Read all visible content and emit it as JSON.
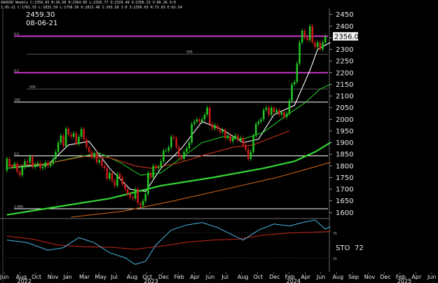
{
  "header": {
    "line1": "XAUUSD Weekly C:2356.03 N:26.58 H:2364.85 L:2326.77 O:2329.48 U:2356.33 V:66.1K O:0",
    "line2": "I:95-21 C:1761.55 L:1831.59 L:1758.56 O:1813.48 I:293.58 I:0 S:2356.03 R:73.03 E:62.54",
    "price": "2459.30",
    "date": "08-06-21"
  },
  "chart_data": {
    "type": "line",
    "title": "",
    "ylim": [
      1580,
      2470
    ],
    "yticks": [
      1600,
      1650,
      1700,
      1750,
      1800,
      1850,
      1900,
      1950,
      2000,
      2050,
      2100,
      2150,
      2200,
      2250,
      2300,
      2350,
      2400,
      2450
    ],
    "last_price_label": "2356.03",
    "last_price": 2356.03,
    "horizontal_lines": [
      {
        "value": 2357,
        "color": "#c838c8",
        "label": "0.0"
      },
      {
        "value": 2200,
        "color": "#c838c8",
        "label": "0.2"
      },
      {
        "value": 2074,
        "color": "#ffffff",
        "label": "100"
      },
      {
        "value": 1843,
        "color": "#ffffff",
        "label": "0.5"
      },
      {
        "value": 1616,
        "color": "#ffffff",
        "label": "1.000"
      }
    ],
    "level_labels": [
      {
        "value": 2280,
        "label": "500"
      },
      {
        "value": 2130,
        "label": "500"
      }
    ],
    "candles": [
      [
        1780,
        1832
      ],
      [
        1830,
        1800
      ],
      [
        1800,
        1795
      ],
      [
        1795,
        1810
      ],
      [
        1810,
        1775
      ],
      [
        1775,
        1760
      ],
      [
        1760,
        1795
      ],
      [
        1795,
        1820
      ],
      [
        1820,
        1815
      ],
      [
        1815,
        1840
      ],
      [
        1840,
        1795
      ],
      [
        1795,
        1805
      ],
      [
        1805,
        1812
      ],
      [
        1812,
        1790
      ],
      [
        1790,
        1795
      ],
      [
        1795,
        1815
      ],
      [
        1815,
        1800
      ],
      [
        1800,
        1810
      ],
      [
        1810,
        1830
      ],
      [
        1830,
        1860
      ],
      [
        1860,
        1900
      ],
      [
        1900,
        1930
      ],
      [
        1930,
        1885
      ],
      [
        1885,
        1960
      ],
      [
        1960,
        1935
      ],
      [
        1935,
        1925
      ],
      [
        1925,
        1940
      ],
      [
        1940,
        1895
      ],
      [
        1895,
        1925
      ],
      [
        1925,
        1958
      ],
      [
        1958,
        1915
      ],
      [
        1915,
        1880
      ],
      [
        1880,
        1860
      ],
      [
        1860,
        1840
      ],
      [
        1840,
        1855
      ],
      [
        1855,
        1815
      ],
      [
        1815,
        1825
      ],
      [
        1825,
        1800
      ],
      [
        1800,
        1790
      ],
      [
        1790,
        1745
      ],
      [
        1745,
        1770
      ],
      [
        1770,
        1735
      ],
      [
        1735,
        1715
      ],
      [
        1715,
        1765
      ],
      [
        1765,
        1750
      ],
      [
        1750,
        1720
      ],
      [
        1720,
        1700
      ],
      [
        1700,
        1680
      ],
      [
        1680,
        1665
      ],
      [
        1665,
        1660
      ],
      [
        1660,
        1700
      ],
      [
        1700,
        1640
      ],
      [
        1640,
        1630
      ],
      [
        1630,
        1650
      ],
      [
        1650,
        1680
      ],
      [
        1680,
        1770
      ],
      [
        1770,
        1750
      ],
      [
        1750,
        1800
      ],
      [
        1800,
        1790
      ],
      [
        1790,
        1795
      ],
      [
        1795,
        1820
      ],
      [
        1820,
        1865
      ],
      [
        1865,
        1865
      ],
      [
        1865,
        1880
      ],
      [
        1880,
        1925
      ],
      [
        1925,
        1920
      ],
      [
        1920,
        1880
      ],
      [
        1880,
        1840
      ],
      [
        1840,
        1830
      ],
      [
        1830,
        1860
      ],
      [
        1860,
        1875
      ],
      [
        1875,
        1900
      ],
      [
        1900,
        1980
      ],
      [
        1980,
        1990
      ],
      [
        1990,
        2000
      ],
      [
        2000,
        1990
      ],
      [
        1990,
        2000
      ],
      [
        2000,
        2020
      ],
      [
        2020,
        2050
      ],
      [
        2050,
        1980
      ],
      [
        1980,
        1960
      ],
      [
        1960,
        1975
      ],
      [
        1975,
        1960
      ],
      [
        1960,
        1945
      ],
      [
        1945,
        1955
      ],
      [
        1955,
        1920
      ],
      [
        1920,
        1930
      ],
      [
        1930,
        1905
      ],
      [
        1905,
        1920
      ],
      [
        1920,
        1930
      ],
      [
        1930,
        1910
      ],
      [
        1910,
        1920
      ],
      [
        1920,
        1890
      ],
      [
        1890,
        1870
      ],
      [
        1870,
        1830
      ],
      [
        1830,
        1860
      ],
      [
        1860,
        1930
      ],
      [
        1930,
        1980
      ],
      [
        1980,
        1990
      ],
      [
        1990,
        2000
      ],
      [
        2000,
        2040
      ],
      [
        2040,
        2050
      ],
      [
        2050,
        2020
      ],
      [
        2020,
        2050
      ],
      [
        2050,
        2030
      ],
      [
        2030,
        2040
      ],
      [
        2040,
        2020
      ],
      [
        2020,
        2030
      ],
      [
        2030,
        2010
      ],
      [
        2010,
        2025
      ],
      [
        2025,
        2080
      ],
      [
        2080,
        2150
      ],
      [
        2150,
        2160
      ],
      [
        2160,
        2240
      ],
      [
        2240,
        2330
      ],
      [
        2330,
        2380
      ],
      [
        2380,
        2350
      ],
      [
        2350,
        2340
      ],
      [
        2340,
        2400
      ],
      [
        2400,
        2330
      ],
      [
        2330,
        2310
      ],
      [
        2310,
        2330
      ],
      [
        2330,
        2300
      ],
      [
        2300,
        2330
      ],
      [
        2330,
        2356
      ]
    ],
    "series": [
      {
        "color": "#ffffff",
        "values": [
          [
            0,
            1790
          ],
          [
            8,
            1800
          ],
          [
            16,
            1805
          ],
          [
            24,
            1890
          ],
          [
            32,
            1905
          ],
          [
            40,
            1790
          ],
          [
            48,
            1700
          ],
          [
            54,
            1690
          ],
          [
            60,
            1790
          ],
          [
            68,
            1875
          ],
          [
            76,
            1990
          ],
          [
            84,
            1955
          ],
          [
            92,
            1900
          ],
          [
            98,
            1915
          ],
          [
            104,
            2020
          ],
          [
            112,
            2060
          ],
          [
            118,
            2210
          ],
          [
            121,
            2300
          ],
          [
            126,
            2330
          ]
        ]
      },
      {
        "color": "#22c622",
        "values": [
          [
            0,
            1790
          ],
          [
            12,
            1800
          ],
          [
            24,
            1830
          ],
          [
            36,
            1855
          ],
          [
            44,
            1815
          ],
          [
            52,
            1760
          ],
          [
            60,
            1770
          ],
          [
            68,
            1835
          ],
          [
            76,
            1900
          ],
          [
            84,
            1925
          ],
          [
            92,
            1915
          ],
          [
            100,
            1945
          ],
          [
            108,
            2010
          ],
          [
            116,
            2070
          ],
          [
            122,
            2130
          ],
          [
            126,
            2150
          ]
        ]
      },
      {
        "color": "#c83018",
        "values": [
          [
            0,
            1800
          ],
          [
            16,
            1810
          ],
          [
            30,
            1840
          ],
          [
            40,
            1835
          ],
          [
            50,
            1800
          ],
          [
            56,
            1790
          ],
          [
            66,
            1810
          ],
          [
            78,
            1850
          ],
          [
            88,
            1880
          ],
          [
            96,
            1890
          ],
          [
            104,
            1925
          ],
          [
            110,
            1950
          ]
        ]
      },
      {
        "color": "#36d636",
        "values": [
          [
            0,
            1590
          ],
          [
            20,
            1625
          ],
          [
            40,
            1660
          ],
          [
            60,
            1715
          ],
          [
            80,
            1750
          ],
          [
            100,
            1790
          ],
          [
            112,
            1820
          ],
          [
            120,
            1860
          ],
          [
            126,
            1900
          ]
        ]
      },
      {
        "color": "#c86018",
        "values": [
          [
            25,
            1580
          ],
          [
            45,
            1605
          ],
          [
            65,
            1650
          ],
          [
            85,
            1700
          ],
          [
            105,
            1750
          ],
          [
            118,
            1790
          ],
          [
            126,
            1815
          ]
        ]
      }
    ],
    "stochastic": {
      "label": "STO",
      "value": "72",
      "ylim": [
        0,
        100
      ],
      "yticks": [
        25,
        75
      ],
      "k_color": "#4ab6e6",
      "d_color": "#c82818",
      "k": [
        [
          0,
          60
        ],
        [
          8,
          55
        ],
        [
          16,
          40
        ],
        [
          22,
          45
        ],
        [
          28,
          65
        ],
        [
          34,
          55
        ],
        [
          40,
          35
        ],
        [
          46,
          25
        ],
        [
          50,
          12
        ],
        [
          54,
          18
        ],
        [
          58,
          50
        ],
        [
          64,
          80
        ],
        [
          70,
          90
        ],
        [
          76,
          95
        ],
        [
          82,
          85
        ],
        [
          88,
          70
        ],
        [
          92,
          60
        ],
        [
          98,
          80
        ],
        [
          104,
          92
        ],
        [
          110,
          88
        ],
        [
          116,
          96
        ],
        [
          120,
          100
        ],
        [
          124,
          82
        ],
        [
          126,
          87
        ]
      ],
      "d": [
        [
          0,
          68
        ],
        [
          10,
          62
        ],
        [
          20,
          50
        ],
        [
          30,
          47
        ],
        [
          40,
          46
        ],
        [
          50,
          42
        ],
        [
          60,
          48
        ],
        [
          70,
          56
        ],
        [
          80,
          60
        ],
        [
          90,
          62
        ],
        [
          100,
          70
        ],
        [
          110,
          74
        ],
        [
          120,
          76
        ],
        [
          126,
          77
        ]
      ]
    },
    "x_axis": {
      "labels": [
        "Jun",
        "Aug",
        "Oct",
        "Nov",
        "Jan",
        "Mar",
        "May",
        "Jul",
        "Aug",
        "Oct",
        "Dec",
        "Feb",
        "Apr",
        "Jun",
        "Jul",
        "Aug",
        "Oct",
        "Dec",
        "Feb",
        "Apr",
        "Jun",
        "Aug",
        "Sep",
        "Nov",
        "Dec",
        "Feb",
        "Apr",
        "Jun"
      ],
      "years": [
        {
          "label": "2022",
          "after": "Aug"
        },
        {
          "label": "2023",
          "after": "Oct"
        },
        {
          "label": "2024",
          "after": "Feb"
        },
        {
          "label": "2025",
          "after": "Feb"
        }
      ]
    },
    "colors": {
      "up": "#22c622",
      "down": "#c81818",
      "grid": "#2a2a2a"
    }
  }
}
